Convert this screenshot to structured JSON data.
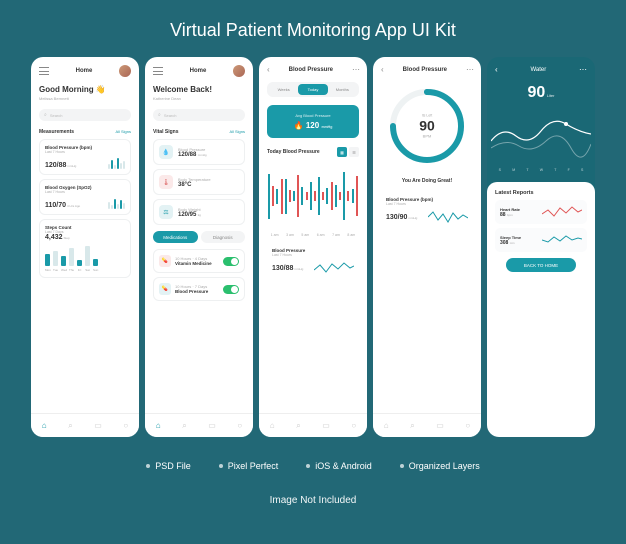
{
  "title": "Virtual Patient Monitoring App UI Kit",
  "features": [
    "PSD File",
    "Pixel Perfect",
    "iOS & Android",
    "Organized Layers"
  ],
  "disclaimer": "Image Not Included",
  "screens": {
    "home1": {
      "header_title": "Home",
      "greeting": "Good Morning",
      "greeting_emoji": "👋",
      "greeting_sub": "Melissa Bernnett",
      "search_placeholder": "Search",
      "measurements_title": "Measurements",
      "measurements_link": "All Signs",
      "bp": {
        "label": "Blood Pressure (bpm)",
        "sub": "Last 7 Hours",
        "value": "120/88",
        "unit": "mmHg"
      },
      "spo2": {
        "label": "Blood Oxygen (SpO2)",
        "sub": "Last 7 Hours",
        "value": "110/70",
        "unit": "4 Hrs Ago"
      },
      "steps": {
        "label": "Steps Count",
        "sub": "Last 7 Days",
        "value": "4,432",
        "unit": "Step",
        "days": [
          "Mon",
          "Tue",
          "Wed",
          "Thu",
          "Fri",
          "Sat",
          "Sun"
        ]
      }
    },
    "home2": {
      "header_title": "Home",
      "greeting": "Welcome Back!",
      "greeting_sub": "Katherine Dean",
      "search_placeholder": "Search",
      "vitals_title": "Vital Signs",
      "vitals_link": "All Signs",
      "vitals": [
        {
          "label": "Blood Pressure",
          "value": "120/88",
          "unit": "mmHg"
        },
        {
          "label": "Body Temperature",
          "value": "38°C"
        },
        {
          "label": "Body Weight",
          "value": "120/95",
          "unit": "kg"
        }
      ],
      "tabs": {
        "medications": "Medications",
        "diagnosis": "Diagnosis"
      },
      "meds": [
        {
          "time": "10 Hours · 4 Days",
          "name": "Vitamin Medicine",
          "on": true
        },
        {
          "time": "10 Hours · 7 Days",
          "name": "Blood Pressure",
          "on": true
        }
      ]
    },
    "bp_detail": {
      "header_title": "Blood Pressure",
      "periods": [
        "Weeks",
        "Today",
        "Months"
      ],
      "period_active": 1,
      "avg_label": "Avg Blood Pressure",
      "avg_value": "120",
      "avg_unit": "mmHg",
      "today_label": "Today Blood Pressure",
      "times": [
        "1 am",
        "3 am",
        "5 am",
        "6 am",
        "7 am",
        "8 am"
      ],
      "footer_label": "Blood Pressure",
      "footer_sub": "Last 7 Hours",
      "footer_value": "130/88",
      "footer_unit": "mmHg"
    },
    "bp_gauge": {
      "header_title": "Blood Pressure",
      "gauge_sub": "Its Left",
      "gauge_value": "90",
      "gauge_unit": "BPM",
      "encourage": "You Are Doing Great!",
      "summary_label": "Blood Pressure (bpm)",
      "summary_sub": "Last 7 Hours",
      "summary_value": "130/90",
      "summary_unit": "mmHg"
    },
    "water": {
      "header_title": "Water",
      "value": "90",
      "unit": "Liter",
      "days": [
        "S",
        "M",
        "T",
        "W",
        "T",
        "F",
        "S"
      ],
      "reports_title": "Latest Reports",
      "reports": [
        {
          "name": "Heart Rate",
          "value": "88",
          "unit": "bpm"
        },
        {
          "name": "Sleep Time",
          "value": "308",
          "unit": "min"
        }
      ],
      "back_btn": "BACK TO HOME"
    }
  },
  "chart_data": [
    {
      "type": "bar",
      "title": "Steps Count",
      "categories": [
        "Mon",
        "Tue",
        "Wed",
        "Thu",
        "Fri",
        "Sat",
        "Sun"
      ],
      "values": [
        55,
        70,
        45,
        80,
        25,
        90,
        30
      ],
      "ylim": [
        0,
        100
      ]
    },
    {
      "type": "bar",
      "title": "Today Blood Pressure",
      "categories": [
        "1 am",
        "3 am",
        "5 am",
        "6 am",
        "7 am",
        "8 am"
      ],
      "series": [
        {
          "name": "high",
          "values": [
            45,
            15,
            35,
            10,
            18,
            28,
            38,
            16,
            22,
            48,
            14
          ]
        },
        {
          "name": "low",
          "values": [
            20,
            35,
            12,
            42,
            8,
            10,
            8,
            28,
            8,
            10,
            40
          ]
        }
      ]
    },
    {
      "type": "gauge",
      "title": "Blood Pressure",
      "value": 90,
      "max": 120,
      "unit": "BPM"
    },
    {
      "type": "line",
      "title": "Water",
      "categories": [
        "S",
        "M",
        "T",
        "W",
        "T",
        "F",
        "S"
      ],
      "values": [
        65,
        80,
        55,
        75,
        90,
        60,
        70
      ],
      "ylim": [
        0,
        100
      ]
    },
    {
      "type": "line",
      "title": "Heart Rate",
      "values": [
        40,
        55,
        35,
        60,
        45,
        65,
        50
      ]
    },
    {
      "type": "line",
      "title": "Sleep Time",
      "values": [
        50,
        40,
        55,
        45,
        60,
        48,
        52
      ]
    }
  ]
}
